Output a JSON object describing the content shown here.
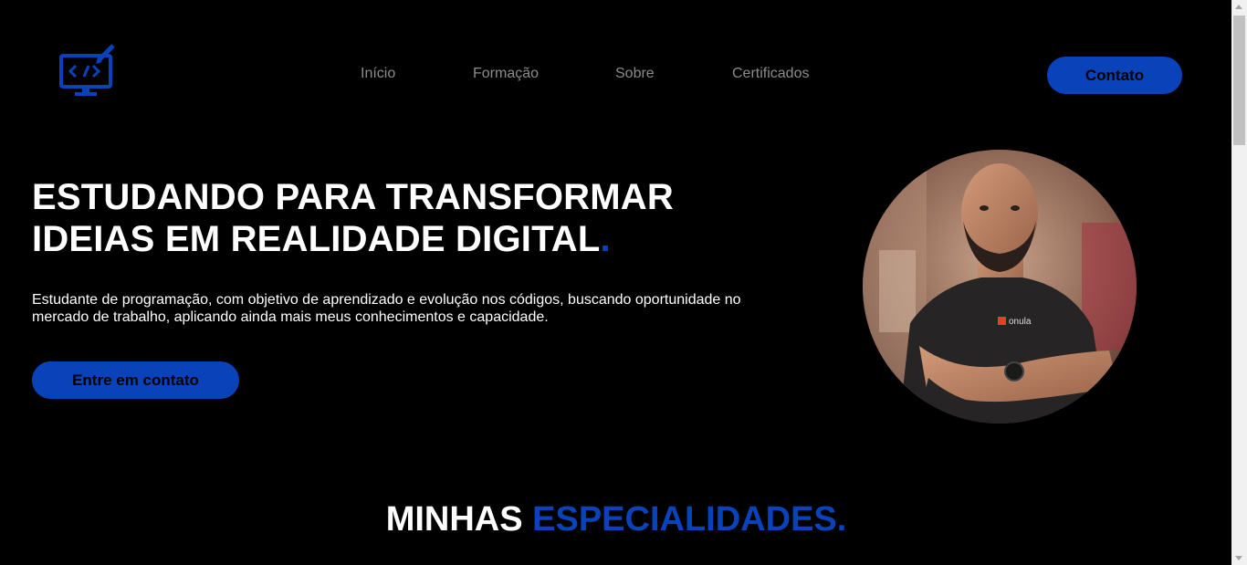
{
  "header": {
    "logo_icon": "code-monitor-icon",
    "nav": [
      {
        "label": "Início"
      },
      {
        "label": "Formação"
      },
      {
        "label": "Sobre"
      },
      {
        "label": "Certificados"
      }
    ],
    "contact_button": "Contato"
  },
  "hero": {
    "title_line1": "ESTUDANDO PARA TRANSFORMAR",
    "title_line2": "IDEIAS EM REALIDADE DIGITAL",
    "title_dot": ".",
    "description": "Estudante de programação, com objetivo de aprendizado e evolução nos códigos, buscando oportunidade no mercado de trabalho, aplicando ainda mais meus conhecimentos e capacidade.",
    "cta_button": "Entre em contato",
    "shirt_text": "onula",
    "photo_icon": "profile-photo"
  },
  "specialties": {
    "title_part1": "MINHAS",
    "title_part2": "ESPECIALIDADES."
  },
  "colors": {
    "background": "#000000",
    "accent": "#0a42ba",
    "nav_text": "#8c8c8c"
  }
}
